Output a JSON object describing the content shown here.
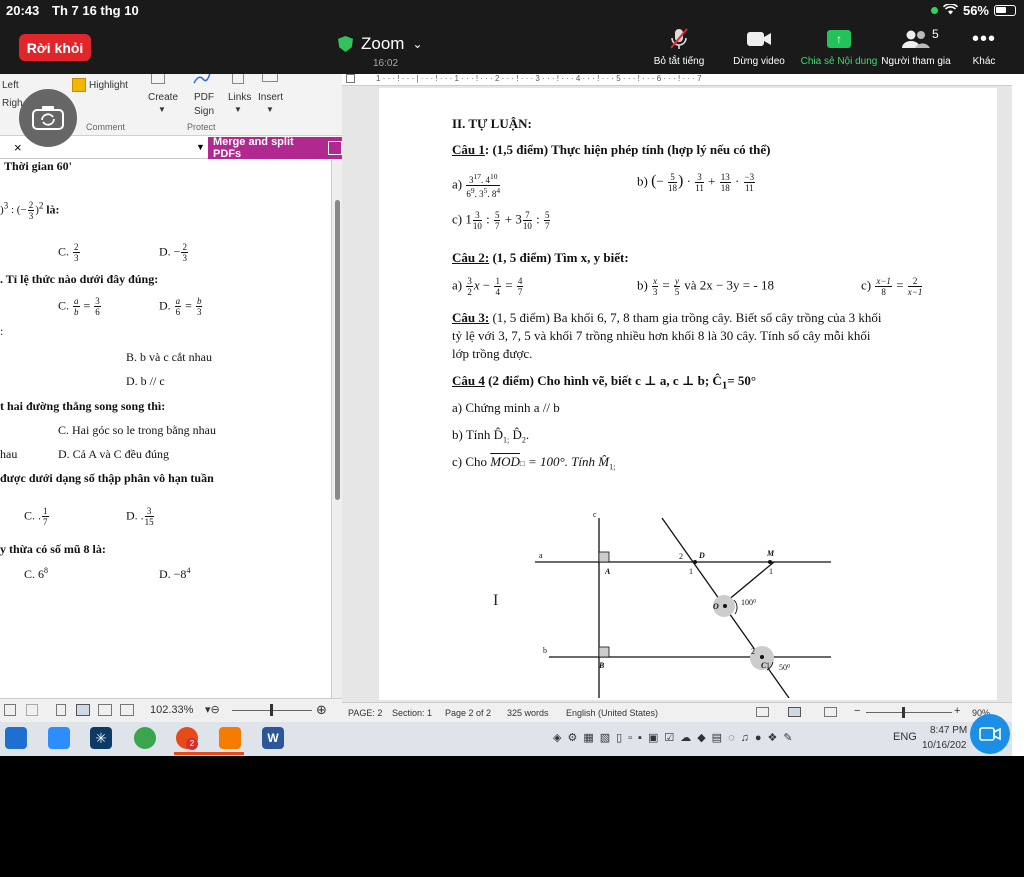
{
  "status": {
    "time": "20:43",
    "date": "Th 7 16 thg 10",
    "battery": "56%"
  },
  "zoom": {
    "leave": "Rời khỏi",
    "title": "Zoom",
    "timer": "16:02",
    "participants_count": "5",
    "controls": {
      "mute": "Bỏ tắt tiếng",
      "stop_video": "Dừng video",
      "share": "Chia sẻ Nội dung",
      "participants": "Người tham gia",
      "more": "Khác"
    }
  },
  "pdf": {
    "ribbon": {
      "left": "Left",
      "right": "Righ",
      "highlight": "Highlight",
      "create": "Create",
      "pdf_sign_1": "PDF",
      "pdf_sign_2": "Sign",
      "links": "Links",
      "insert": "Insert",
      "group_comment": "Comment",
      "group_protect": "Protect"
    },
    "merge": "Merge and split PDFs",
    "tab_close": "×",
    "lines": {
      "l1": "Thời gian 60'",
      "l2b": "là:",
      "l3a": "C.",
      "l3b": "D. −",
      "l4": ". Tỉ lệ thức nào dưới đây đúng:",
      "l5a": "C.",
      "l5b": "D.",
      "l7": "B. b và c cắt nhau",
      "l8": "D.  b // c",
      "l9": "t hai đường thẳng song song thì:",
      "l10": "C. Hai góc so le trong bằng nhau",
      "l11a": "hau",
      "l11b": "D. Cả A và C đều đúng",
      "l12": " được dưới dạng số thập phân vô hạn tuần",
      "l13a": "C. .",
      "l13b": "D. .",
      "l14": "y thừa có số mũ 8 là:",
      "l15a": "C. 6",
      "l15a_sup": "8",
      "l15b": "D. −8",
      "l15b_sup": "4"
    },
    "zoom_level": "102.33%"
  },
  "word": {
    "heading": "II. TỰ LUẬN:",
    "q1_label": "Câu 1",
    "q1_text": ": (1,5 điểm) Thực hiện phép tính (hợp lý nếu có thể)",
    "q1_a": "a)",
    "q1_b": "b)",
    "q1_c": "c)",
    "q2_label": "Câu 2:",
    "q2_text": " (1, 5 điểm) Tìm x, y biết:",
    "q2_a": "a)",
    "q2_b": "b)",
    "q2_b_tail": "và  2x − 3y = - 18",
    "q2_c": "c)",
    "q3_label": "Câu 3:",
    "q3_text1": " (1, 5 điểm) Ba khối 6, 7, 8 tham gia trồng cây. Biết số cây trồng của 3 khối",
    "q3_text2": "tỷ lệ với 3, 7, 5 và khối 7 trồng nhiều hơn khối 8 là 30 cây. Tính số cây mỗi khối",
    "q3_text3": "lớp trồng được.",
    "q4_label": "Câu 4",
    "q4_text": " (2 điểm) Cho hình vẽ, biết c ⊥ a, c ⊥ b; Ĉ",
    "q4_text_sub": "1",
    "q4_text_tail": "= 50°",
    "q4_a": "a) Chứng minh a // b",
    "q4_b": "b) Tính D̂",
    "q4_b_sub1": "1;",
    "q4_b_mid": " D̂",
    "q4_b_sub2": "2",
    "q4_b_tail": ".",
    "q4_c": "c) Cho ",
    "q4_c_mid": "MOD",
    "q4_c_tail": " = 100°. Tính M̂",
    "q4_c_sub": "1;",
    "fig": {
      "c": "c",
      "a": "a",
      "b": "b",
      "A": "A",
      "B": "B",
      "D": "D",
      "M": "M",
      "O": "O",
      "C": "C",
      "n1": "1",
      "n2": "2",
      "n1m": "1",
      "n2c": "2",
      "n1c": "1",
      "ang100": "100⁰",
      "ang50": "50⁰"
    },
    "status": {
      "page": "PAGE: 2",
      "section": "Section: 1",
      "pages": "Page 2 of 2",
      "words": "325 words",
      "lang": "English (United States)",
      "zoom": "90%"
    }
  },
  "taskbar": {
    "lang": "ENG",
    "time": "8:47 PM",
    "date": "10/16/202",
    "badge": "2"
  }
}
